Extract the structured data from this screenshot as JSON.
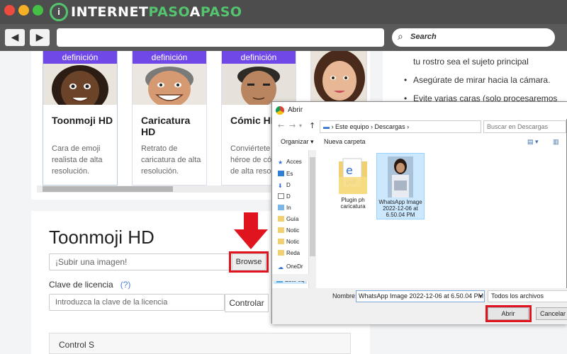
{
  "browser": {
    "logo_prefix": "INTERNET",
    "logo_green": "PASO",
    "logo_mid": "A",
    "logo_suffix": "PASO",
    "back_icon": "back-arrow-icon",
    "forward_icon": "forward-arrow-icon",
    "search_placeholder": "Search"
  },
  "cards": [
    {
      "badge": "definición",
      "title": "Toonmoji HD",
      "desc": "Cara de emoji realista de alta resolución."
    },
    {
      "badge": "definición",
      "title": "Caricatura HD",
      "desc": "Retrato de caricatura de alta resolución."
    },
    {
      "badge": "definición",
      "title": "Cómic HD",
      "desc": "Conviértete en un héroe de cómic de alta resolución."
    }
  ],
  "tips": [
    "tu rostro sea el sujeto principal",
    "Asegúrate de mirar hacia la cámara.",
    "Evite varias caras (solo procesaremos"
  ],
  "form": {
    "title": "Toonmoji HD",
    "upload_placeholder": "¡Subir una imagen!",
    "browse_label": "Browse",
    "license_label": "Clave de licencia",
    "license_help": "(?)",
    "license_placeholder": "Introduzca la clave de la licencia",
    "control_label": "Controlar",
    "control_s_label": "Control S"
  },
  "dialog": {
    "title": "Abrir",
    "path_root": "Este equipo",
    "path_folder": "Descargas",
    "search_placeholder": "Buscar en Descargas",
    "organize_label": "Organizar ▾",
    "new_folder_label": "Nueva carpeta",
    "nav_items": [
      {
        "label": "Acces",
        "icon": "star-icon"
      },
      {
        "label": "Es",
        "icon": "desktop-icon"
      },
      {
        "label": "D",
        "icon": "download-icon"
      },
      {
        "label": "D",
        "icon": "document-icon"
      },
      {
        "label": "In",
        "icon": "image-icon"
      },
      {
        "label": "Guía",
        "icon": "folder-icon"
      },
      {
        "label": "Notic",
        "icon": "folder-icon"
      },
      {
        "label": "Notic",
        "icon": "folder-icon"
      },
      {
        "label": "Reda",
        "icon": "folder-icon"
      },
      {
        "label": "OneDr",
        "icon": "cloud-icon"
      },
      {
        "label": "Este eq",
        "icon": "computer-icon"
      }
    ],
    "files": [
      {
        "name": "Plugin ph caricatura",
        "icon": "folder-icon"
      },
      {
        "name": "WhatsApp Image 2022-12-06 at 6.50.04 PM",
        "icon": "image-icon"
      }
    ],
    "filename_label": "Nombre:",
    "filename_value": "WhatsApp Image 2022-12-06 at 6.50.04 PM",
    "filetype_value": "Todos los archivos",
    "open_label": "Abrir",
    "cancel_label": "Cancelar"
  },
  "colors": {
    "accent": "#7048e8",
    "highlight": "#e0141e",
    "brand_green": "#54c46e"
  }
}
